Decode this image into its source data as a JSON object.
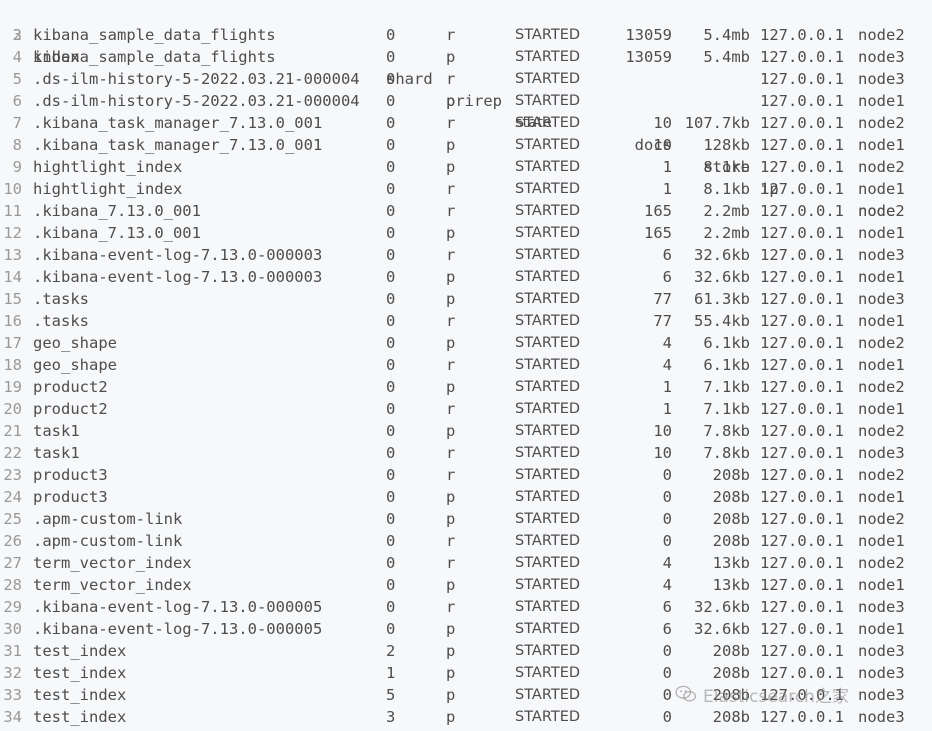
{
  "header": {
    "line": "2",
    "cols": {
      "index": "index",
      "shard": "shard",
      "prirep": "prirep",
      "state": "state",
      "docs": "docs",
      "store": "store",
      "ip": "ip",
      "node": "node"
    }
  },
  "rows": [
    {
      "ln": "3",
      "index": "kibana_sample_data_flights",
      "shard": "0",
      "prirep": "r",
      "state": "STARTED",
      "docs": "13059",
      "store": "5.4mb",
      "ip": "127.0.0.1",
      "node": "node2"
    },
    {
      "ln": "4",
      "index": "kibana_sample_data_flights",
      "shard": "0",
      "prirep": "p",
      "state": "STARTED",
      "docs": "13059",
      "store": "5.4mb",
      "ip": "127.0.0.1",
      "node": "node3"
    },
    {
      "ln": "5",
      "index": ".ds-ilm-history-5-2022.03.21-000004",
      "shard": "0",
      "prirep": "r",
      "state": "STARTED",
      "docs": "",
      "store": "",
      "ip": "127.0.0.1",
      "node": "node3"
    },
    {
      "ln": "6",
      "index": ".ds-ilm-history-5-2022.03.21-000004",
      "shard": "0",
      "prirep": "p",
      "state": "STARTED",
      "docs": "",
      "store": "",
      "ip": "127.0.0.1",
      "node": "node1"
    },
    {
      "ln": "7",
      "index": ".kibana_task_manager_7.13.0_001",
      "shard": "0",
      "prirep": "r",
      "state": "STARTED",
      "docs": "10",
      "store": "107.7kb",
      "ip": "127.0.0.1",
      "node": "node2"
    },
    {
      "ln": "8",
      "index": ".kibana_task_manager_7.13.0_001",
      "shard": "0",
      "prirep": "p",
      "state": "STARTED",
      "docs": "10",
      "store": "128kb",
      "ip": "127.0.0.1",
      "node": "node1"
    },
    {
      "ln": "9",
      "index": "hightlight_index",
      "shard": "0",
      "prirep": "p",
      "state": "STARTED",
      "docs": "1",
      "store": "8.1kb",
      "ip": "127.0.0.1",
      "node": "node2"
    },
    {
      "ln": "10",
      "index": "hightlight_index",
      "shard": "0",
      "prirep": "r",
      "state": "STARTED",
      "docs": "1",
      "store": "8.1kb",
      "ip": "127.0.0.1",
      "node": "node1"
    },
    {
      "ln": "11",
      "index": ".kibana_7.13.0_001",
      "shard": "0",
      "prirep": "r",
      "state": "STARTED",
      "docs": "165",
      "store": "2.2mb",
      "ip": "127.0.0.1",
      "node": "node2"
    },
    {
      "ln": "12",
      "index": ".kibana_7.13.0_001",
      "shard": "0",
      "prirep": "p",
      "state": "STARTED",
      "docs": "165",
      "store": "2.2mb",
      "ip": "127.0.0.1",
      "node": "node1"
    },
    {
      "ln": "13",
      "index": ".kibana-event-log-7.13.0-000003",
      "shard": "0",
      "prirep": "r",
      "state": "STARTED",
      "docs": "6",
      "store": "32.6kb",
      "ip": "127.0.0.1",
      "node": "node3"
    },
    {
      "ln": "14",
      "index": ".kibana-event-log-7.13.0-000003",
      "shard": "0",
      "prirep": "p",
      "state": "STARTED",
      "docs": "6",
      "store": "32.6kb",
      "ip": "127.0.0.1",
      "node": "node1"
    },
    {
      "ln": "15",
      "index": ".tasks",
      "shard": "0",
      "prirep": "p",
      "state": "STARTED",
      "docs": "77",
      "store": "61.3kb",
      "ip": "127.0.0.1",
      "node": "node3"
    },
    {
      "ln": "16",
      "index": ".tasks",
      "shard": "0",
      "prirep": "r",
      "state": "STARTED",
      "docs": "77",
      "store": "55.4kb",
      "ip": "127.0.0.1",
      "node": "node1"
    },
    {
      "ln": "17",
      "index": "geo_shape",
      "shard": "0",
      "prirep": "p",
      "state": "STARTED",
      "docs": "4",
      "store": "6.1kb",
      "ip": "127.0.0.1",
      "node": "node2"
    },
    {
      "ln": "18",
      "index": "geo_shape",
      "shard": "0",
      "prirep": "r",
      "state": "STARTED",
      "docs": "4",
      "store": "6.1kb",
      "ip": "127.0.0.1",
      "node": "node1"
    },
    {
      "ln": "19",
      "index": "product2",
      "shard": "0",
      "prirep": "p",
      "state": "STARTED",
      "docs": "1",
      "store": "7.1kb",
      "ip": "127.0.0.1",
      "node": "node2"
    },
    {
      "ln": "20",
      "index": "product2",
      "shard": "0",
      "prirep": "r",
      "state": "STARTED",
      "docs": "1",
      "store": "7.1kb",
      "ip": "127.0.0.1",
      "node": "node1"
    },
    {
      "ln": "21",
      "index": "task1",
      "shard": "0",
      "prirep": "p",
      "state": "STARTED",
      "docs": "10",
      "store": "7.8kb",
      "ip": "127.0.0.1",
      "node": "node2"
    },
    {
      "ln": "22",
      "index": "task1",
      "shard": "0",
      "prirep": "r",
      "state": "STARTED",
      "docs": "10",
      "store": "7.8kb",
      "ip": "127.0.0.1",
      "node": "node3"
    },
    {
      "ln": "23",
      "index": "product3",
      "shard": "0",
      "prirep": "r",
      "state": "STARTED",
      "docs": "0",
      "store": "208b",
      "ip": "127.0.0.1",
      "node": "node2"
    },
    {
      "ln": "24",
      "index": "product3",
      "shard": "0",
      "prirep": "p",
      "state": "STARTED",
      "docs": "0",
      "store": "208b",
      "ip": "127.0.0.1",
      "node": "node1"
    },
    {
      "ln": "25",
      "index": ".apm-custom-link",
      "shard": "0",
      "prirep": "p",
      "state": "STARTED",
      "docs": "0",
      "store": "208b",
      "ip": "127.0.0.1",
      "node": "node2"
    },
    {
      "ln": "26",
      "index": ".apm-custom-link",
      "shard": "0",
      "prirep": "r",
      "state": "STARTED",
      "docs": "0",
      "store": "208b",
      "ip": "127.0.0.1",
      "node": "node1"
    },
    {
      "ln": "27",
      "index": "term_vector_index",
      "shard": "0",
      "prirep": "r",
      "state": "STARTED",
      "docs": "4",
      "store": "13kb",
      "ip": "127.0.0.1",
      "node": "node2"
    },
    {
      "ln": "28",
      "index": "term_vector_index",
      "shard": "0",
      "prirep": "p",
      "state": "STARTED",
      "docs": "4",
      "store": "13kb",
      "ip": "127.0.0.1",
      "node": "node1"
    },
    {
      "ln": "29",
      "index": ".kibana-event-log-7.13.0-000005",
      "shard": "0",
      "prirep": "r",
      "state": "STARTED",
      "docs": "6",
      "store": "32.6kb",
      "ip": "127.0.0.1",
      "node": "node3"
    },
    {
      "ln": "30",
      "index": ".kibana-event-log-7.13.0-000005",
      "shard": "0",
      "prirep": "p",
      "state": "STARTED",
      "docs": "6",
      "store": "32.6kb",
      "ip": "127.0.0.1",
      "node": "node1"
    },
    {
      "ln": "31",
      "index": "test_index",
      "shard": "2",
      "prirep": "p",
      "state": "STARTED",
      "docs": "0",
      "store": "208b",
      "ip": "127.0.0.1",
      "node": "node3"
    },
    {
      "ln": "32",
      "index": "test_index",
      "shard": "1",
      "prirep": "p",
      "state": "STARTED",
      "docs": "0",
      "store": "208b",
      "ip": "127.0.0.1",
      "node": "node3"
    },
    {
      "ln": "33",
      "index": "test_index",
      "shard": "5",
      "prirep": "p",
      "state": "STARTED",
      "docs": "0",
      "store": "208b",
      "ip": "127.0.0.1",
      "node": "node3"
    },
    {
      "ln": "34",
      "index": "test_index",
      "shard": "3",
      "prirep": "p",
      "state": "STARTED",
      "docs": "0",
      "store": "208b",
      "ip": "127.0.0.1",
      "node": "node3"
    }
  ],
  "watermark": {
    "text": "Elasticsearch之家",
    "icon": "wechat-icon"
  }
}
